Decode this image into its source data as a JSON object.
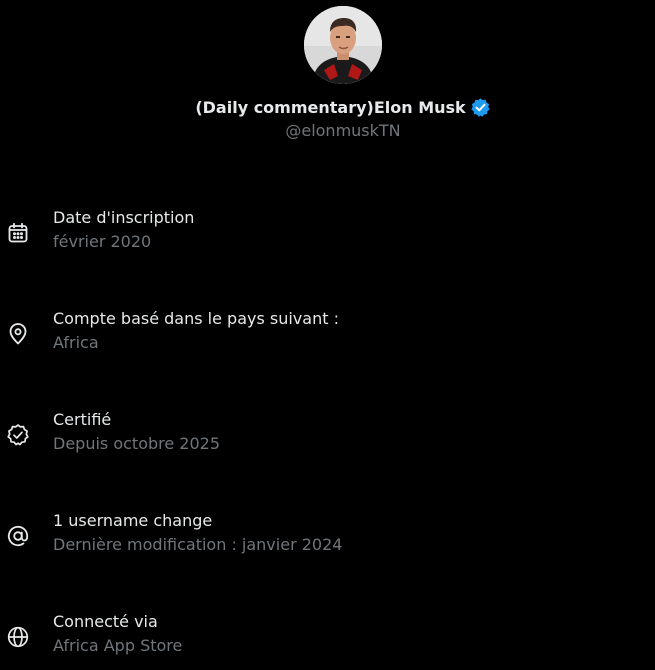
{
  "profile": {
    "display_name": "(Daily commentary)Elon Musk",
    "handle": "@elonmuskTN",
    "verified": true,
    "verified_icon": "verified-badge-icon",
    "avatar_icon": "profile-photo"
  },
  "colors": {
    "background": "#000000",
    "primary_text": "#e7e9ea",
    "secondary_text": "#71767b",
    "verified_blue": "#1d9bf0"
  },
  "info_items": [
    {
      "icon": "calendar-icon",
      "label": "Date d'inscription",
      "value": "février 2020"
    },
    {
      "icon": "location-pin-icon",
      "label": "Compte basé dans le pays suivant :",
      "value": "Africa"
    },
    {
      "icon": "verified-check-icon",
      "label": "Certifié",
      "value": "Depuis octobre 2025"
    },
    {
      "icon": "at-sign-icon",
      "label": "1 username change",
      "value": "Dernière modification : janvier 2024"
    },
    {
      "icon": "globe-icon",
      "label": "Connecté via",
      "value": "Africa App Store"
    }
  ]
}
